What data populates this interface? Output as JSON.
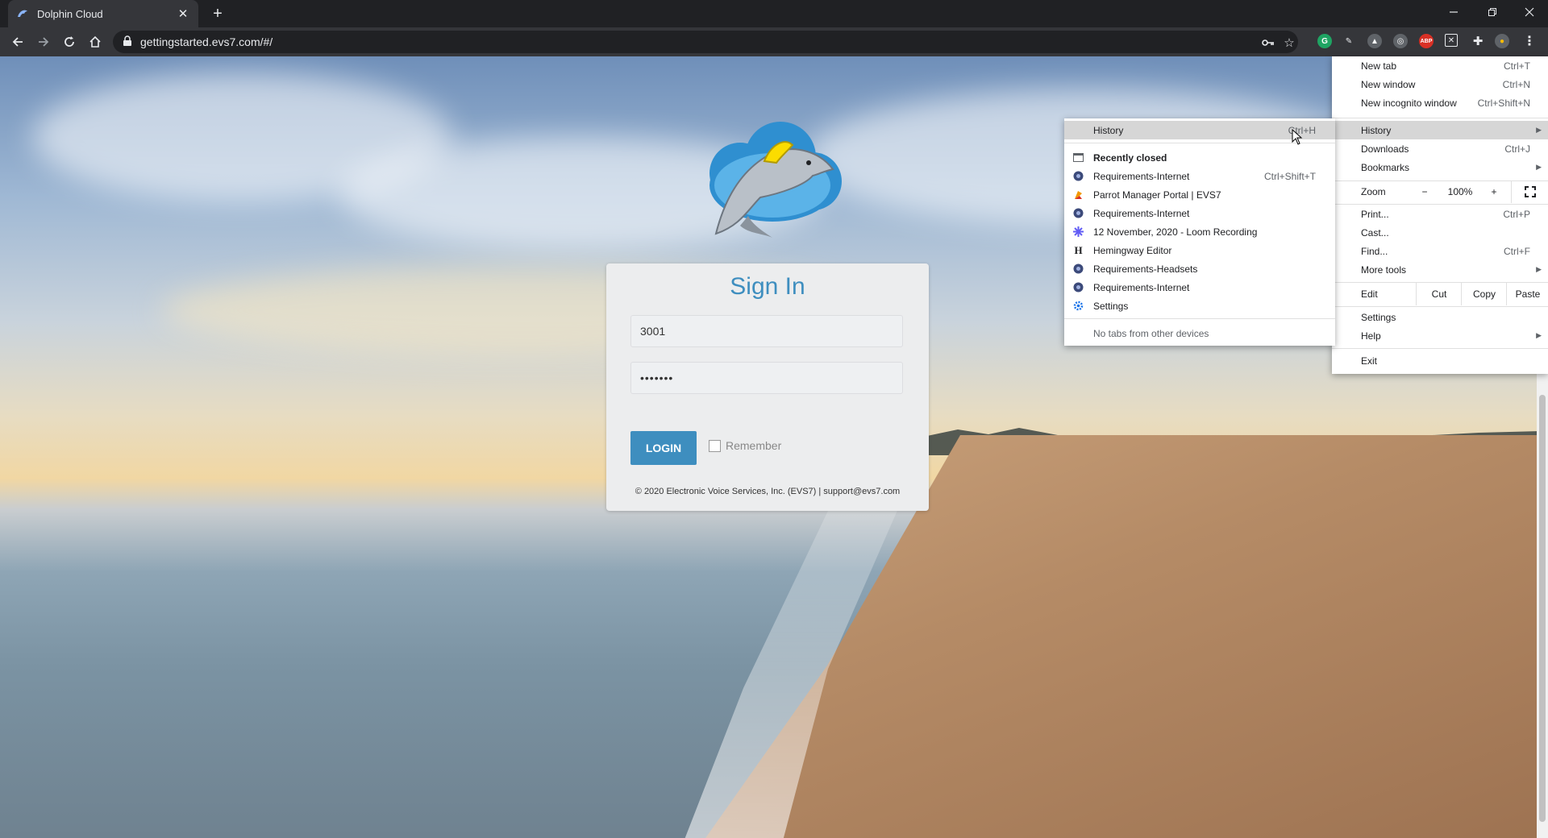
{
  "browser": {
    "tab_title": "Dolphin Cloud",
    "url": "gettingstarted.evs7.com/#/",
    "new_tab_symbol": "+",
    "close_symbol": "✕"
  },
  "signin": {
    "title": "Sign In",
    "username_value": "3001",
    "password_value": "•••••••",
    "login_label": "LOGIN",
    "remember_label": "Remember",
    "footer": "© 2020 Electronic Voice Services, Inc. (EVS7) | support@evs7.com"
  },
  "menu": {
    "new_tab": {
      "label": "New tab",
      "shortcut": "Ctrl+T"
    },
    "new_window": {
      "label": "New window",
      "shortcut": "Ctrl+N"
    },
    "new_incognito": {
      "label": "New incognito window",
      "shortcut": "Ctrl+Shift+N"
    },
    "history": {
      "label": "History"
    },
    "downloads": {
      "label": "Downloads",
      "shortcut": "Ctrl+J"
    },
    "bookmarks": {
      "label": "Bookmarks"
    },
    "zoom": {
      "label": "Zoom",
      "minus": "−",
      "level": "100%",
      "plus": "+"
    },
    "print": {
      "label": "Print...",
      "shortcut": "Ctrl+P"
    },
    "cast": {
      "label": "Cast..."
    },
    "find": {
      "label": "Find...",
      "shortcut": "Ctrl+F"
    },
    "more_tools": {
      "label": "More tools"
    },
    "edit": {
      "label": "Edit",
      "cut": "Cut",
      "copy": "Copy",
      "paste": "Paste"
    },
    "settings": {
      "label": "Settings"
    },
    "help": {
      "label": "Help"
    },
    "exit": {
      "label": "Exit"
    }
  },
  "history_menu": {
    "history": {
      "label": "History",
      "shortcut": "Ctrl+H"
    },
    "recently_closed": "Recently closed",
    "items": [
      {
        "label": "Requirements-Internet",
        "shortcut": "Ctrl+Shift+T",
        "icon": "evs-icon"
      },
      {
        "label": "Parrot Manager Portal | EVS7",
        "shortcut": "",
        "icon": "parrot-icon"
      },
      {
        "label": "Requirements-Internet",
        "shortcut": "",
        "icon": "evs-icon"
      },
      {
        "label": "12 November, 2020 - Loom Recording",
        "shortcut": "",
        "icon": "loom-icon"
      },
      {
        "label": "Hemingway Editor",
        "shortcut": "",
        "icon": "hemingway-icon"
      },
      {
        "label": "Requirements-Headsets",
        "shortcut": "",
        "icon": "evs-icon"
      },
      {
        "label": "Requirements-Internet",
        "shortcut": "",
        "icon": "evs-icon"
      },
      {
        "label": "Settings",
        "shortcut": "",
        "icon": "gear-icon"
      }
    ],
    "no_tabs": "No tabs from other devices"
  },
  "colors": {
    "accent": "#3e8ebf",
    "chrome_dark": "#202124",
    "chrome_toolbar": "#35363a"
  }
}
